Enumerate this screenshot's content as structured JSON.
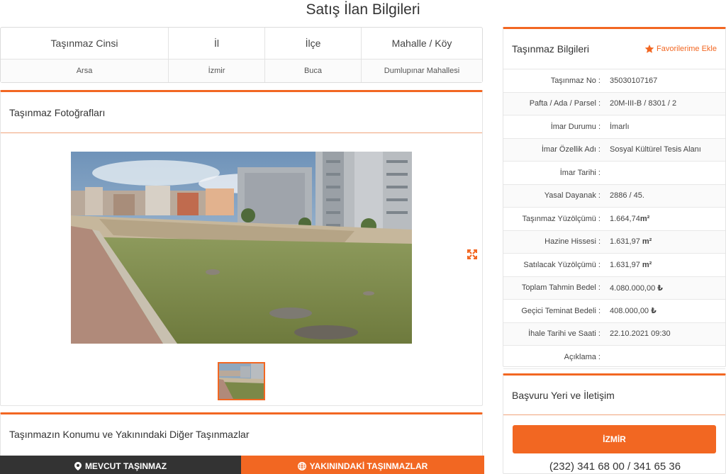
{
  "page": {
    "title": "Satış İlan Bilgileri"
  },
  "property_table": {
    "headers": [
      "Taşınmaz Cinsi",
      "İl",
      "İlçe",
      "Mahalle / Köy"
    ],
    "values": [
      "Arsa",
      "İzmir",
      "Buca",
      "Dumlupınar Mahallesi"
    ]
  },
  "photos": {
    "title": "Taşınmaz Fotoğrafları",
    "expand_icon": "expand-icon"
  },
  "location": {
    "title": "Taşınmazın Konumu ve Yakınındaki Diğer Taşınmazlar",
    "current_button": "MEVCUT TAŞINMAZ",
    "nearby_button": "YAKININDAKİ TAŞINMAZLAR"
  },
  "info": {
    "title": "Taşınmaz Bilgileri",
    "favorite_label": "Favorilerime Ekle",
    "rows": [
      {
        "key": "Taşınmaz No :",
        "value": "35030107167"
      },
      {
        "key": "Pafta / Ada / Parsel :",
        "value": "20M-III-B / 8301 / 2"
      },
      {
        "key": "İmar Durumu :",
        "value": "İmarlı"
      },
      {
        "key": "İmar Özellik Adı :",
        "value": "Sosyal Kültürel Tesis Alanı"
      },
      {
        "key": "İmar Tarihi :",
        "value": ""
      },
      {
        "key": "Yasal Dayanak :",
        "value": "2886 / 45."
      },
      {
        "key": "Taşınmaz Yüzölçümü :",
        "value": "1.664,74",
        "unit": "m²"
      },
      {
        "key": "Hazine Hissesi :",
        "value": "1.631,97 ",
        "unit": "m²"
      },
      {
        "key": "Satılacak Yüzölçümü :",
        "value": "1.631,97 ",
        "unit": "m²"
      },
      {
        "key": "Toplam Tahmin Bedel :",
        "value": "4.080.000,00 ",
        "unit": "₺"
      },
      {
        "key": "Geçici Teminat Bedeli :",
        "value": "408.000,00 ",
        "unit": "₺"
      },
      {
        "key": "İhale Tarihi ve Saati :",
        "value": "22.10.2021 09:30"
      },
      {
        "key": "Açıklama :",
        "value": ""
      }
    ]
  },
  "contact": {
    "title": "Başvuru Yeri ve İletişim",
    "city_button": "İZMİR",
    "phone": "(232) 341 68 00 / 341 65 36"
  },
  "colors": {
    "accent": "#f26722",
    "dark": "#333333"
  }
}
